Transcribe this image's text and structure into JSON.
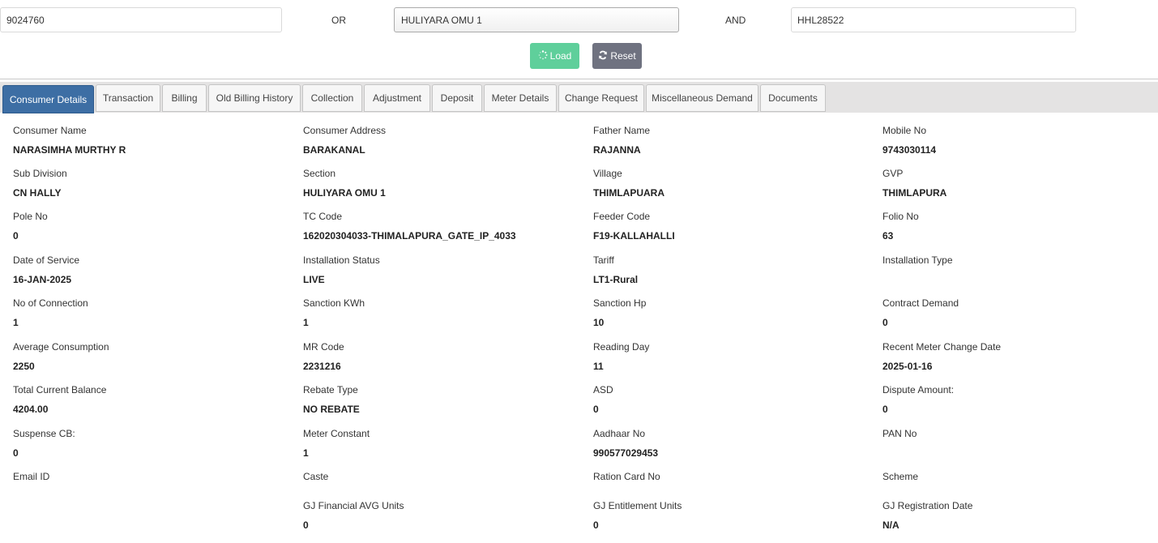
{
  "search": {
    "consumer_no": "9024760",
    "or_label": "OR",
    "section": "HULIYARA OMU 1",
    "and_label": "AND",
    "rr_no": "HHL28522",
    "load_label": "Load",
    "reset_label": "Reset"
  },
  "tabs": [
    {
      "label": "Consumer Details",
      "active": true
    },
    {
      "label": "Transaction"
    },
    {
      "label": "Billing"
    },
    {
      "label": "Old Billing History"
    },
    {
      "label": "Collection"
    },
    {
      "label": "Adjustment"
    },
    {
      "label": "Deposit"
    },
    {
      "label": "Meter Details"
    },
    {
      "label": "Change Request"
    },
    {
      "label": "Miscellaneous Demand"
    },
    {
      "label": "Documents"
    }
  ],
  "fields": [
    [
      {
        "label": "Consumer Name",
        "value": "NARASIMHA MURTHY R"
      },
      {
        "label": "Consumer Address",
        "value": "BARAKANAL"
      },
      {
        "label": "Father Name",
        "value": "RAJANNA"
      },
      {
        "label": "Mobile No",
        "value": "9743030114"
      }
    ],
    [
      {
        "label": "Sub Division",
        "value": "CN HALLY"
      },
      {
        "label": "Section",
        "value": "HULIYARA OMU 1"
      },
      {
        "label": "Village",
        "value": "THIMLAPUARA"
      },
      {
        "label": "GVP",
        "value": "THIMLAPURA"
      }
    ],
    [
      {
        "label": "Pole No",
        "value": "0"
      },
      {
        "label": "TC Code",
        "value": "162020304033-THIMALAPURA_GATE_IP_4033"
      },
      {
        "label": "Feeder Code",
        "value": "F19-KALLAHALLI"
      },
      {
        "label": "Folio No",
        "value": "63"
      }
    ],
    [
      {
        "label": "Date of Service",
        "value": "16-JAN-2025"
      },
      {
        "label": "Installation Status",
        "value": "LIVE"
      },
      {
        "label": "Tariff",
        "value": "LT1-Rural"
      },
      {
        "label": "Installation Type",
        "value": ""
      }
    ],
    [
      {
        "label": "No of Connection",
        "value": "1"
      },
      {
        "label": "Sanction KWh",
        "value": "1"
      },
      {
        "label": "Sanction Hp",
        "value": "10"
      },
      {
        "label": "Contract Demand",
        "value": "0"
      }
    ],
    [
      {
        "label": "Average Consumption",
        "value": "2250"
      },
      {
        "label": "MR Code",
        "value": "2231216"
      },
      {
        "label": "Reading Day",
        "value": "11"
      },
      {
        "label": "Recent Meter Change Date",
        "value": "2025-01-16"
      }
    ],
    [
      {
        "label": "Total Current Balance",
        "value": "4204.00"
      },
      {
        "label": "Rebate Type",
        "value": "NO REBATE"
      },
      {
        "label": "ASD",
        "value": "0"
      },
      {
        "label": "Dispute Amount:",
        "value": "0"
      }
    ],
    [
      {
        "label": "Suspense CB:",
        "value": "0"
      },
      {
        "label": "Meter Constant",
        "value": "1"
      },
      {
        "label": "Aadhaar No",
        "value": "990577029453"
      },
      {
        "label": "PAN No",
        "value": ""
      }
    ],
    [
      {
        "label": "Email ID",
        "value": ""
      },
      {
        "label": "Caste",
        "value": ""
      },
      {
        "label": "Ration Card No",
        "value": ""
      },
      {
        "label": "Scheme",
        "value": ""
      }
    ],
    [
      {
        "label": "",
        "value": ""
      },
      {
        "label": "GJ Financial AVG Units",
        "value": "0"
      },
      {
        "label": "GJ Entitlement Units",
        "value": "0"
      },
      {
        "label": "GJ Registration Date",
        "value": "N/A"
      }
    ]
  ]
}
